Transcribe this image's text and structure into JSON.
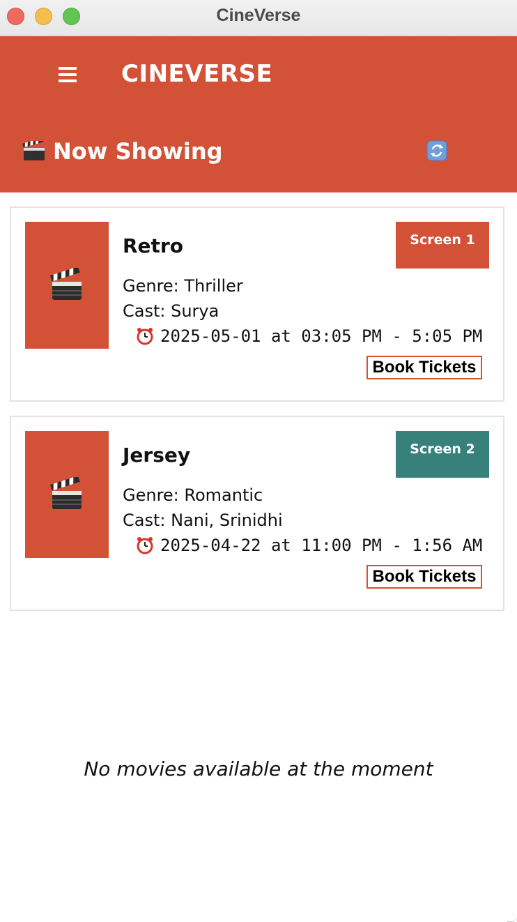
{
  "window": {
    "title": "CineVerse"
  },
  "header": {
    "app_name": "CINEVERSE",
    "section_title": "Now Showing",
    "menu_icon": "hamburger-menu-icon",
    "refresh_icon": "refresh-icon"
  },
  "movies": [
    {
      "title": "Retro",
      "genre": "Genre: Thriller",
      "cast": "Cast: Surya",
      "showtime": "2025-05-01 at 03:05 PM - 5:05 PM",
      "screen": "Screen 1",
      "screen_color": "#d35136",
      "book_label": "Book Tickets"
    },
    {
      "title": "Jersey",
      "genre": "Genre: Romantic",
      "cast": "Cast: Nani, Srinidhi",
      "showtime": "2025-04-22 at 11:00 PM - 1:56 AM",
      "screen": "Screen 2",
      "screen_color": "#38807c",
      "book_label": "Book Tickets"
    }
  ],
  "empty_state": {
    "message": "No movies available at the moment"
  },
  "colors": {
    "accent": "#d35136",
    "teal": "#38807c"
  }
}
